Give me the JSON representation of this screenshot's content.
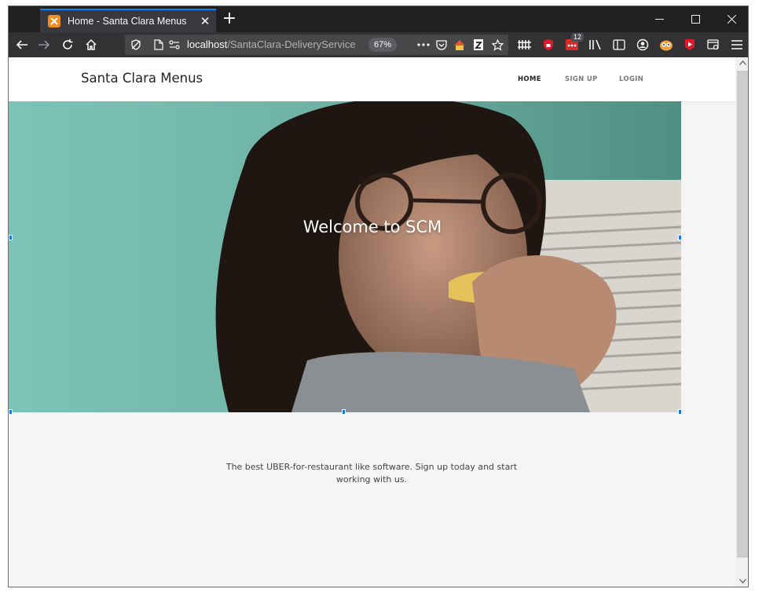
{
  "browser": {
    "tab_title": "Home - Santa Clara Menus",
    "tab_close_glyph": "✕",
    "new_tab_glyph": "+",
    "url_host": "localhost",
    "url_path": "/SantaClara-DeliveryService",
    "zoom": "67%",
    "addon_badge_count": "12",
    "colors": {
      "titlebar": "#202020",
      "toolbar": "#323234",
      "tab_accent": "#0a84ff",
      "favicon": "#f28c1e"
    }
  },
  "site": {
    "brand": "Santa Clara Menus",
    "nav": {
      "home": "HOME",
      "signup": "SIGN UP",
      "login": "LOGIN"
    },
    "hero": {
      "title": "Welcome to SCM"
    },
    "tagline": "The best UBER-for-restaurant like software. Sign up today and start working with us."
  }
}
